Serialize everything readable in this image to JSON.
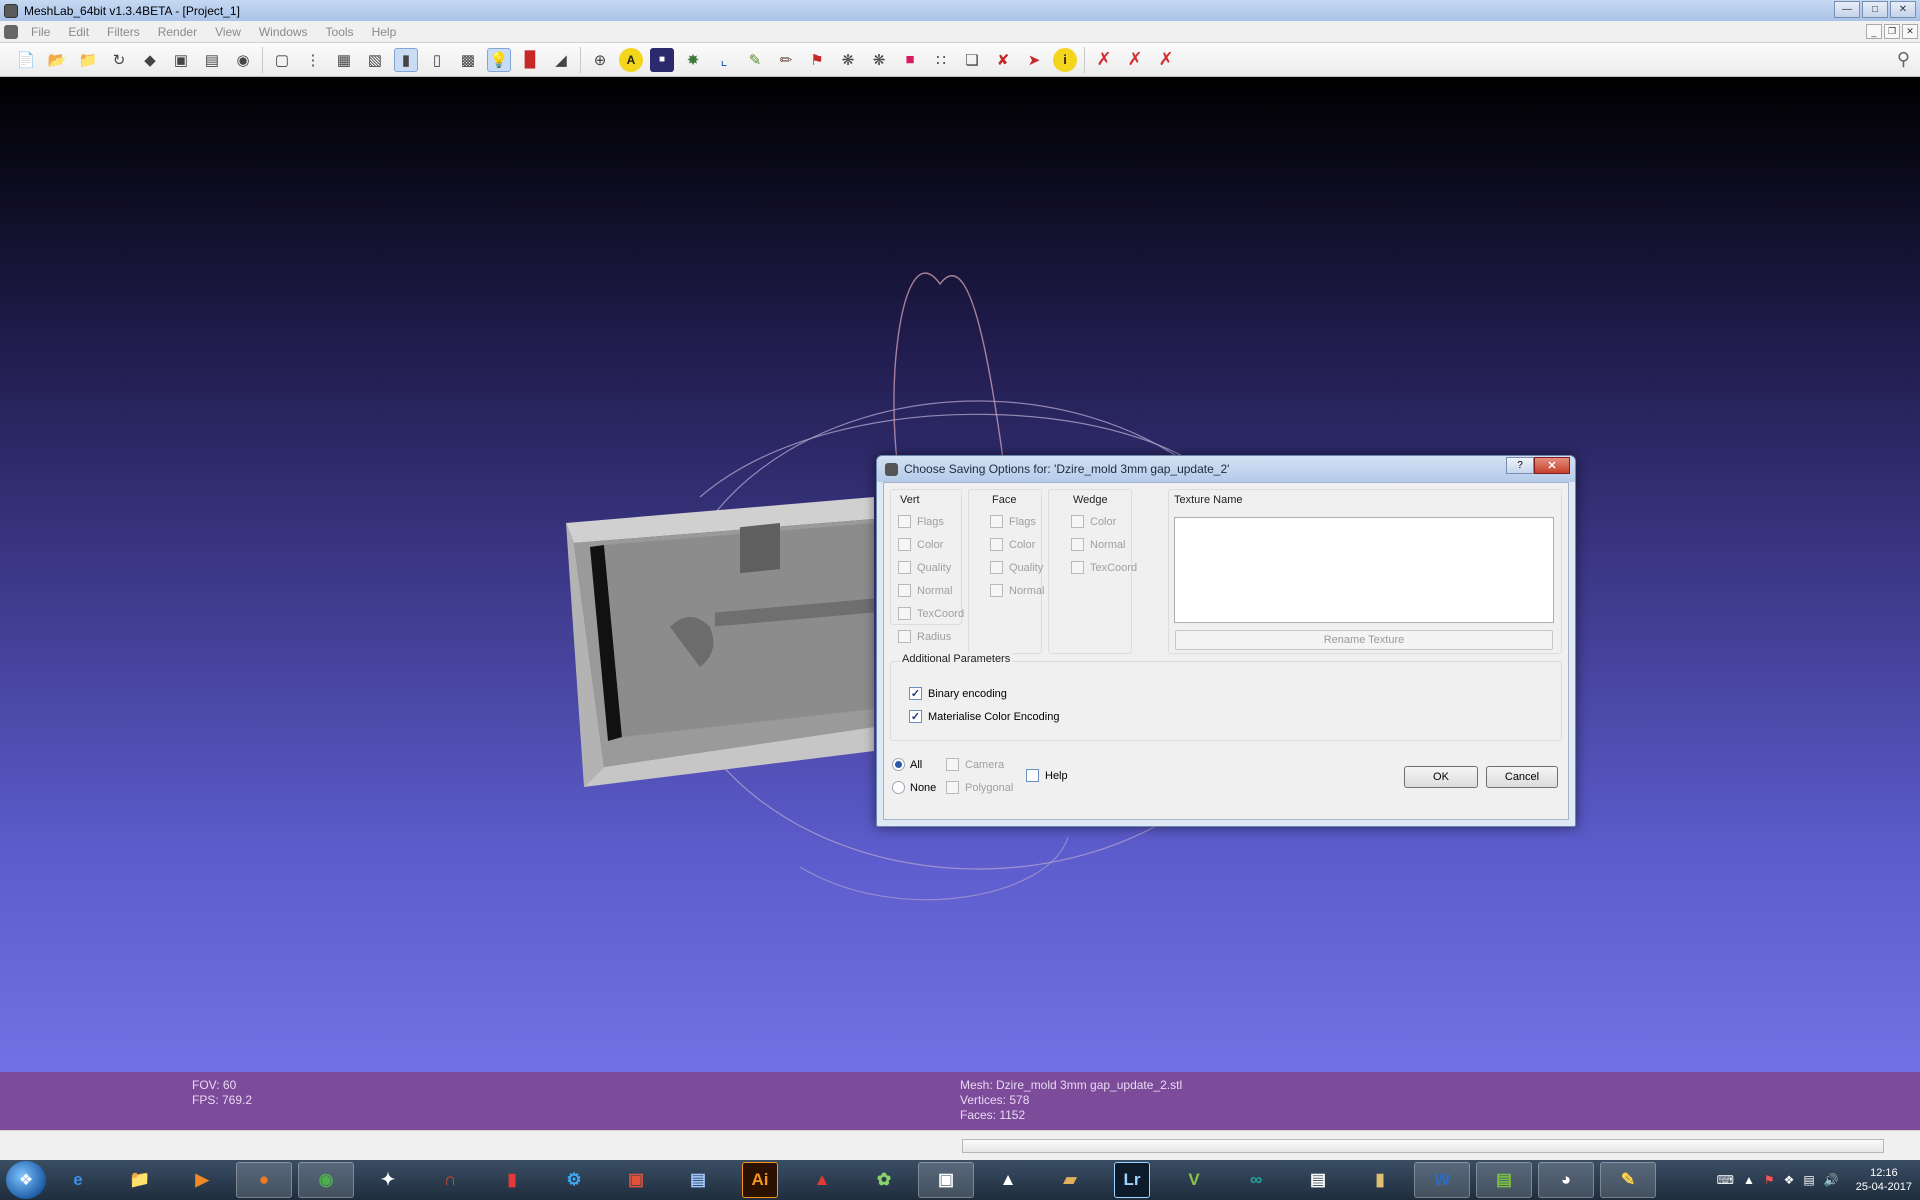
{
  "window": {
    "title": "MeshLab_64bit v1.3.4BETA - [Project_1]",
    "background_titles": "MeshLab_64bit v1.3.4BETA - [Project_1]"
  },
  "menu": [
    "File",
    "Edit",
    "Filters",
    "Render",
    "View",
    "Windows",
    "Tools",
    "Help"
  ],
  "viewport": {
    "fov": "FOV: 60",
    "fps": "FPS:   769.2",
    "mesh": "Mesh: Dzire_mold 3mm gap_update_2.stl",
    "vertices": "Vertices: 578",
    "faces": "Faces: 1152"
  },
  "dialog": {
    "title": "Choose Saving Options for: 'Dzire_mold 3mm gap_update_2'",
    "vert": {
      "title": "Vert",
      "items": [
        "Flags",
        "Color",
        "Quality",
        "Normal",
        "TexCoord",
        "Radius"
      ]
    },
    "face": {
      "title": "Face",
      "items": [
        "Flags",
        "Color",
        "Quality",
        "Normal"
      ]
    },
    "wedge": {
      "title": "Wedge",
      "items": [
        "Color",
        "Normal",
        "TexCoord"
      ]
    },
    "texture": {
      "title": "Texture Name",
      "rename": "Rename Texture"
    },
    "additional": {
      "title": "Additional Parameters",
      "binary": "Binary encoding",
      "materialise": "Materialise Color Encoding"
    },
    "all": "All",
    "none": "None",
    "camera": "Camera",
    "polygonal": "Polygonal",
    "help": "Help",
    "ok": "OK",
    "cancel": "Cancel"
  },
  "tray": {
    "time": "12:16",
    "date": "25-04-2017"
  },
  "taskbar_labels": {
    "illustrator": "Ai",
    "lightroom": "Lr"
  },
  "icons": {
    "toolbar": [
      "new-file-icon",
      "open-file-icon",
      "open-project-icon",
      "reload-icon",
      "save-snapshot-icon",
      "screenshot-icon",
      "layers-icon",
      "save-icon",
      "bounding-box-icon",
      "points-icon",
      "wireframe-icon",
      "hidden-lines-icon",
      "flat-shading-icon",
      "smooth-shading-icon",
      "texture-icon",
      "light-icon",
      "color-icon",
      "doublesided-icon",
      "trackball-icon",
      "annotation-icon",
      "vertex-quality-icon",
      "mesh-icon",
      "axis-icon",
      "paint-icon",
      "brush-icon",
      "select-faces-icon",
      "select-vertices-icon",
      "select-connected-icon",
      "color-select-icon",
      "align-icon",
      "measure-icon",
      "point-picker-icon",
      "manipulate-icon",
      "info-icon",
      "delete-faces-icon",
      "delete-vertices-icon",
      "delete-all-icon"
    ]
  },
  "colors": {
    "accent": "#2a5ba8",
    "infobar": "#7c4b9a",
    "viewport_top": "#000000",
    "viewport_bottom": "#7272e4"
  }
}
